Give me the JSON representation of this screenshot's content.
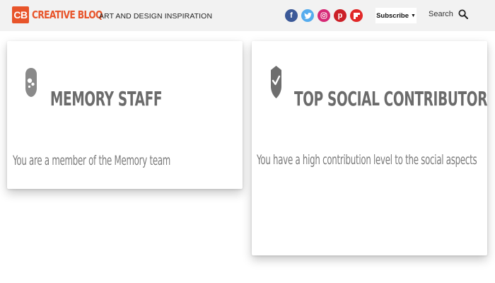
{
  "header": {
    "logo_mark": "CB",
    "logo_name": "CREATIVE BLOQ",
    "tagline": "ART AND DESIGN INSPIRATION",
    "socials": [
      {
        "icon": "facebook-icon",
        "glyph": "f",
        "color": "#3b5998"
      },
      {
        "icon": "twitter-icon",
        "glyph": "t",
        "color": "#55acee"
      },
      {
        "icon": "instagram-icon",
        "glyph": "◎",
        "color": "#d62976"
      },
      {
        "icon": "pinterest-icon",
        "glyph": "p",
        "color": "#cb2027"
      },
      {
        "icon": "flipboard-icon",
        "glyph": "f",
        "color": "#e12828"
      }
    ],
    "subscribe_label": "Subscribe",
    "subscribe_arrow": "▼",
    "search_label": "Search",
    "accent_color": "#e8542a"
  },
  "cards": [
    {
      "icon": "memory-staff-badge-icon",
      "title": "MEMORY STAFF",
      "description": "You are a member of the Memory team"
    },
    {
      "icon": "shield-check-icon",
      "title": "TOP SOCIAL CONTRIBUTOR",
      "description": "You have a high contribution level to the social aspects"
    }
  ]
}
